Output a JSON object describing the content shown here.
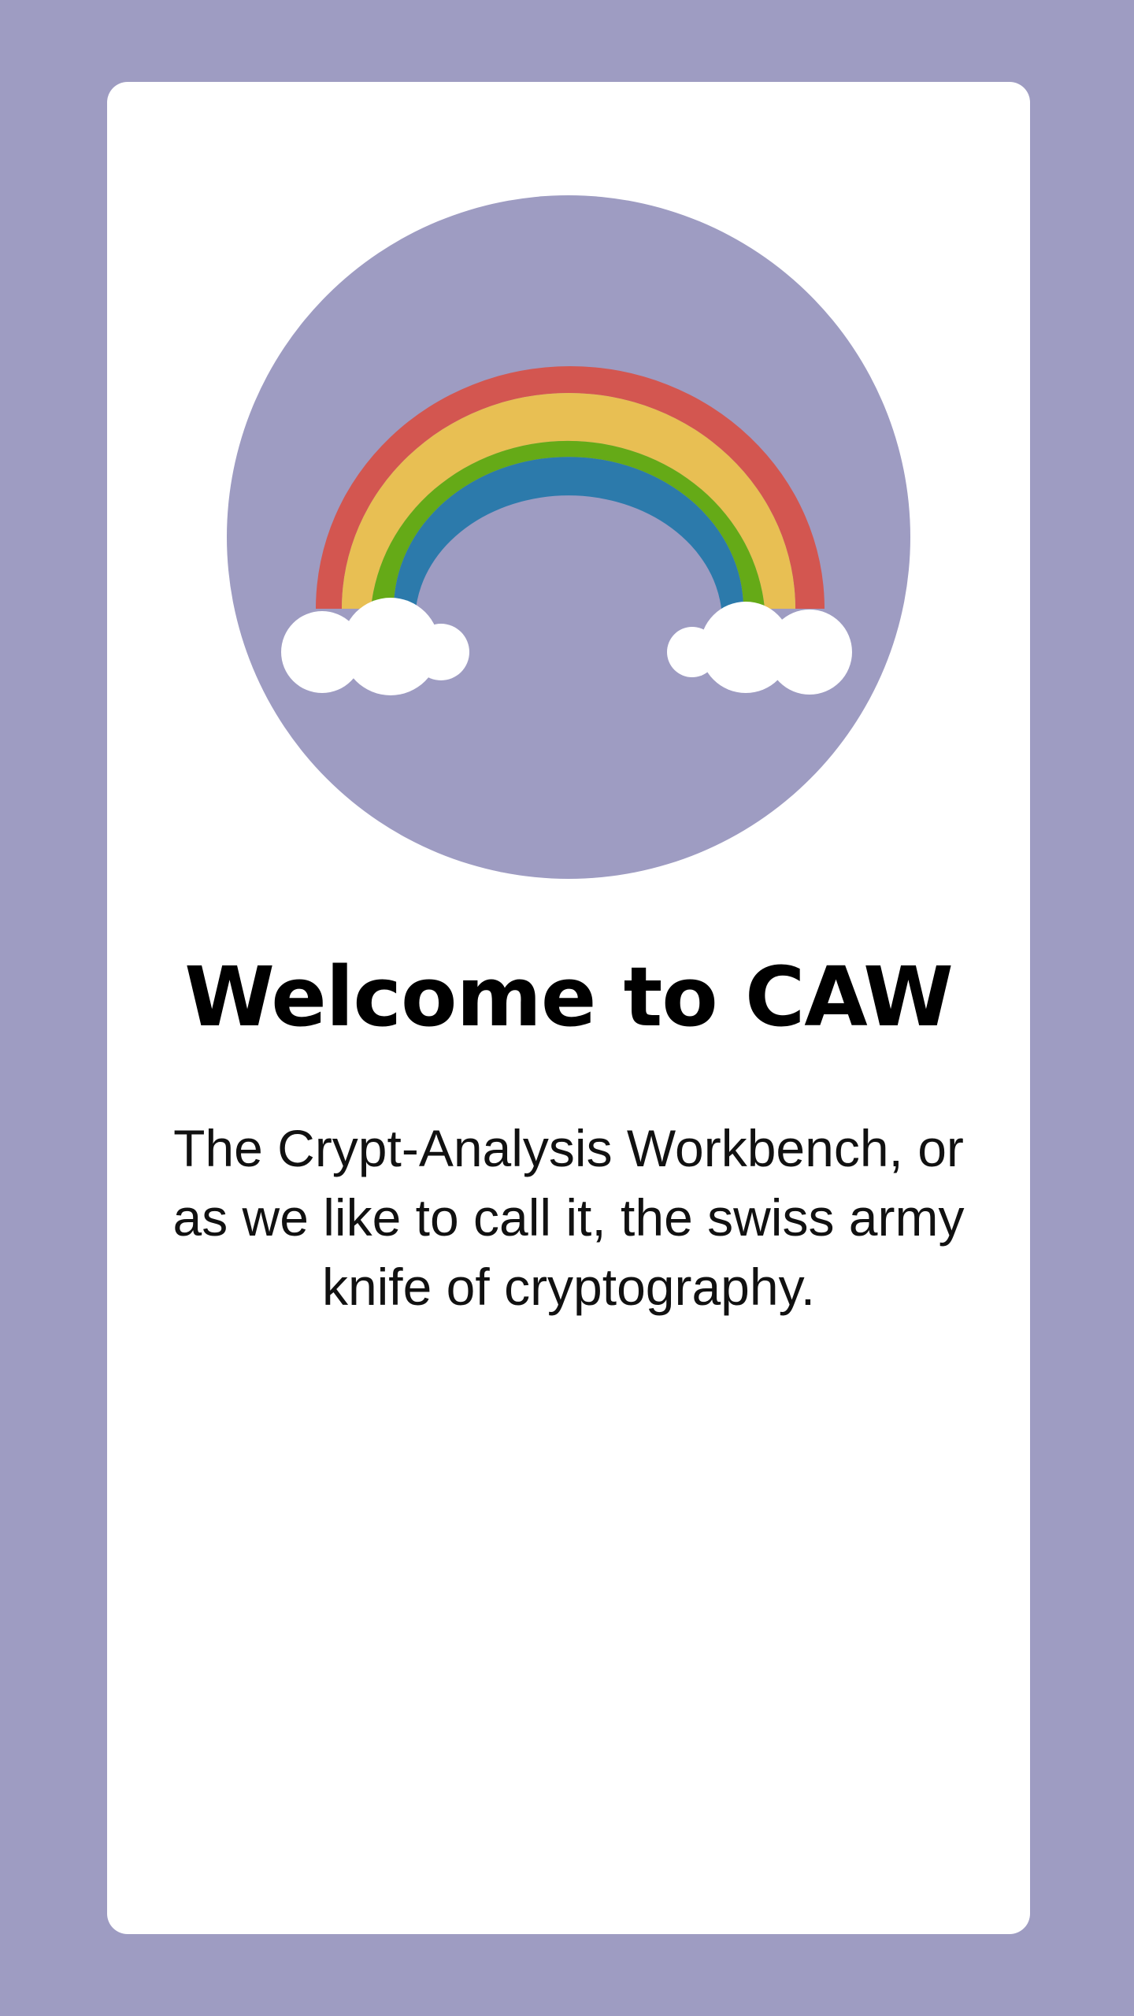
{
  "welcome": {
    "title": "Welcome to CAW",
    "description": "The Crypt-Analysis Workbench, or as we like to call it, the swiss army knife of cryptography.",
    "illustration": "rainbow-with-clouds-icon"
  },
  "colors": {
    "page_background": "#9e9cc2",
    "card_background": "#ffffff",
    "circle_background": "#9e9cc2",
    "rainbow_red": "#d35650",
    "rainbow_yellow": "#e8bf53",
    "rainbow_green": "#65aa17",
    "rainbow_blue": "#2c7aab",
    "cloud": "#ffffff"
  }
}
